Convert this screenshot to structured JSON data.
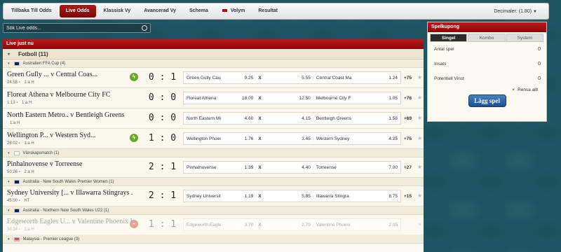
{
  "nav": {
    "tabs": [
      {
        "label": "Tillbaka Till Odds",
        "active": false
      },
      {
        "label": "Live Odds",
        "active": true
      },
      {
        "label": "Klassisk Vy",
        "active": false
      },
      {
        "label": "Avancerad Vy",
        "active": false
      },
      {
        "label": "Schema",
        "active": false
      },
      {
        "label": "Volym",
        "active": false
      },
      {
        "label": "Resultat",
        "active": false
      }
    ],
    "decimals_label": "Decimaler: (1.80)"
  },
  "search": {
    "placeholder": "Sök Live odds..."
  },
  "live": {
    "header": "Live just nu",
    "sport": "Fotboll (11)",
    "groups": [
      {
        "league": "Australien FFA Cup (4)",
        "flag": "au",
        "matches": [
          {
            "teams": "Green Gully ... v Central Coas...",
            "time": "24:55",
            "half": "1:a H",
            "icon": "bolt",
            "score": "0 : 1",
            "home": "Green Gully Cava",
            "o1": "9.25",
            "x": "X",
            "ox": "5.55",
            "away": "Central Coast Ma",
            "o2": "1.24",
            "more": "+75"
          },
          {
            "teams": "Floreat Athena v Melbourne City FC",
            "time": "1:13",
            "half": "1:a H",
            "icon": "",
            "score": "0 : 0",
            "home": "Floreat Athena",
            "o1": "18.00",
            "x": "X",
            "ox": "12.50",
            "away": "Melbourne City F",
            "o2": "1.05",
            "more": "+76"
          },
          {
            "teams": "North Eastern Metro.. v Bentleigh Greens",
            "time": "",
            "half": "1:a H",
            "icon": "",
            "score": "0 : 0",
            "home": "North Eastern Me",
            "o1": "4.60",
            "x": "X",
            "ox": "4.15",
            "away": "Bentleigh Greens",
            "o2": "1.58",
            "more": "+69"
          },
          {
            "teams": "Wellington P... v Western Syd...",
            "time": "28:02",
            "half": "1:a H",
            "icon": "bolt",
            "score": "1 : 0",
            "home": "Wellington Phoen",
            "o1": "1.76",
            "x": "X",
            "ox": "3.45",
            "away": "Western Sydney",
            "o2": "4.25",
            "more": "+75"
          }
        ]
      },
      {
        "league": "Vänskapsmatch (1)",
        "flag": "fi",
        "matches": [
          {
            "teams": "Pinhalnovense v Torreense",
            "time": "50:26",
            "half": "2:a H",
            "icon": "",
            "score": "2 : 1",
            "home": "Pinhalnovense",
            "o1": "1.39",
            "x": "X",
            "ox": "4.40",
            "away": "Torreense",
            "o2": "7.00",
            "more": "+27"
          }
        ]
      },
      {
        "league": "Australia - New South Wales Premier Women (1)",
        "flag": "au",
        "matches": [
          {
            "teams": "Sydney University [... v Illawarra Stingrays ...",
            "time": "45:00",
            "half": "HT",
            "icon": "",
            "score": "2 : 1",
            "home": "Sydney Universit",
            "o1": "1.19",
            "x": "X",
            "ox": "5.85",
            "away": "Illawarra Stingra",
            "o2": "8.75",
            "more": "+15"
          }
        ]
      },
      {
        "league": "Australia - Northern New South Wales U22 (1)",
        "flag": "au",
        "matches": [
          {
            "teams": "Edgeworth Eagles U... v Valentine Phoenix U...",
            "time": "38:34",
            "half": "1:a H",
            "icon": "card",
            "score": "1 : 1",
            "faded": true,
            "home": "Edgeworth Eagle",
            "o1": "3.70",
            "x": "X",
            "ox": "2.70",
            "away": "Valentine Phoeni",
            "o2": "2.05",
            "more": ""
          }
        ]
      },
      {
        "league": "Malaysia - Premier League (3)",
        "flag": "my",
        "matches": []
      }
    ]
  },
  "slip": {
    "header": "Spelkupong",
    "tabs": [
      {
        "label": "Singel",
        "active": true
      },
      {
        "label": "Kombo",
        "active": false
      },
      {
        "label": "System",
        "active": false
      }
    ],
    "rows": [
      {
        "label": "Antal spel",
        "value": "0"
      },
      {
        "label": "Insats",
        "value": "0"
      },
      {
        "label": "Potentiell Vinst",
        "value": "0"
      }
    ],
    "clear_label": "Rensa allt",
    "place_label": "Lägg spel"
  },
  "colors": {
    "accent": "#a01010",
    "background": "#1f5563",
    "button": "#2a5ea4"
  }
}
